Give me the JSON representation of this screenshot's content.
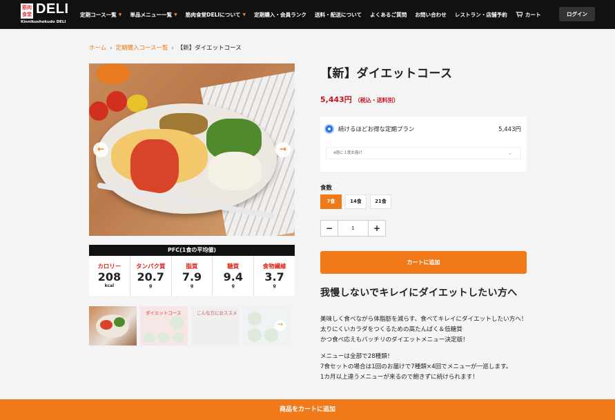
{
  "header": {
    "logo_box": "筋肉\n食堂",
    "logo_deli": "DELI",
    "logo_sub": "Kinnikushokudo DELI",
    "nav": [
      {
        "label": "定期コース一覧",
        "chevron": true
      },
      {
        "label": "単品メニュー一覧",
        "chevron": true
      },
      {
        "label": "筋肉食堂DELIについて",
        "chevron": true
      },
      {
        "label": "定期購入・会員ランク",
        "chevron": false
      },
      {
        "label": "送料・配送について",
        "chevron": false
      },
      {
        "label": "よくあるご質問",
        "chevron": false
      },
      {
        "label": "お問い合わせ",
        "chevron": false
      },
      {
        "label": "レストラン・店舗予約",
        "chevron": false
      }
    ],
    "cart_label": "カート",
    "login_label": "ログイン",
    "cart_icon": "cart-icon",
    "accent": "#f07a1a"
  },
  "breadcrumb": {
    "home": "ホーム",
    "courses": "定期購入コース一覧",
    "current": "【新】ダイエットコース",
    "sep": "›"
  },
  "gallery": {
    "prev": "←",
    "next": "→",
    "thumb2_title": "ダイエットコース",
    "thumb3_title": "こんな方におススメ"
  },
  "pfc": {
    "title": "PFC(1食の平均値)",
    "items": [
      {
        "label": "カロリー",
        "value": "208",
        "unit": "kcal"
      },
      {
        "label": "タンパク質",
        "value": "20.7",
        "unit": "g"
      },
      {
        "label": "脂質",
        "value": "7.9",
        "unit": "g"
      },
      {
        "label": "糖質",
        "value": "9.4",
        "unit": "g"
      },
      {
        "label": "食物繊維",
        "value": "3.7",
        "unit": "g"
      }
    ]
  },
  "product": {
    "title": "【新】ダイエットコース",
    "price": "5,443円",
    "tax_note": "（税込・送料別）",
    "plan_label": "続けるほどお得な定期プラン",
    "plan_price": "5,443円",
    "plan_interval": "4週に１度お届け",
    "qty_label": "食数",
    "qty_options": [
      "7食",
      "14食",
      "21食"
    ],
    "qty_selected": "7食",
    "minus": "−",
    "quantity": "1",
    "plus": "+",
    "add_to_cart": "カートに追加"
  },
  "description": {
    "heading": "我慢しないでキレイにダイエットしたい方へ",
    "p1": "美味しく食べながら体脂肪を減らす、食べてキレイにダイエットしたい方へ！",
    "p2": "太りにくいカラダをつくるための高たんぱく＆低糖質",
    "p3": "かつ食べ応えもバッチリのダイエットメニュー決定版！",
    "p4": "メニューは全部で28種類！",
    "p5": "7食セットの場合は1回のお届けで7種類×4回でメニューが一巡します。",
    "p6": "1カ月以上違うメニューが来るので飽きずに続けられます！"
  },
  "sticky_cart": "商品をカートに追加"
}
